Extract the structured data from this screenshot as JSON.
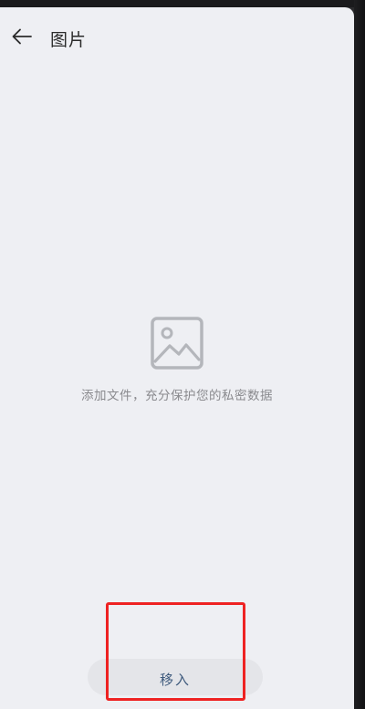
{
  "header": {
    "back_icon": "back-arrow-icon",
    "title": "图片"
  },
  "empty_state": {
    "icon": "picture-icon",
    "message": "添加文件，充分保护您的私密数据"
  },
  "bottom_action": {
    "label": "移入"
  },
  "colors": {
    "background": "#eeeff3",
    "icon_gray": "#b4b6bb",
    "button_bg": "#e4e5e9",
    "button_text": "#3e5a7d",
    "highlight": "#ee2222"
  }
}
